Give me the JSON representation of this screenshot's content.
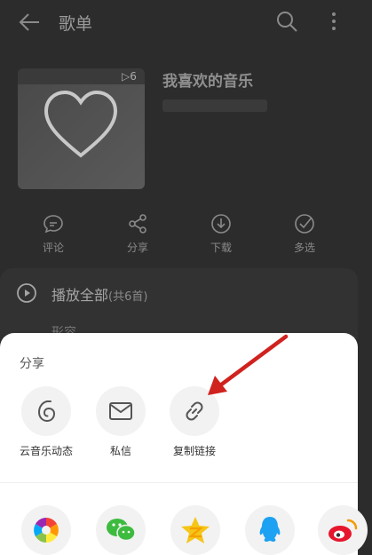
{
  "header": {
    "title": "歌单",
    "icons": [
      "back-arrow-icon",
      "search-icon",
      "more-vertical-icon"
    ]
  },
  "playlist": {
    "name": "我喜欢的音乐",
    "play_count": "6"
  },
  "actions": [
    {
      "label": "评论",
      "icon": "comment-icon"
    },
    {
      "label": "分享",
      "icon": "share-icon"
    },
    {
      "label": "下载",
      "icon": "download-icon"
    },
    {
      "label": "多选",
      "icon": "multi-select-icon"
    }
  ],
  "play_all": {
    "label": "播放全部",
    "count": "(共6首)",
    "first_song_peek": "形容"
  },
  "share_sheet": {
    "title": "分享",
    "options": [
      {
        "label": "云音乐动态",
        "icon": "cloud-music-feed-icon"
      },
      {
        "label": "私信",
        "icon": "mail-icon"
      },
      {
        "label": "复制链接",
        "icon": "link-icon"
      }
    ],
    "apps": [
      {
        "name": "moments",
        "icon": "wechat-moments-icon"
      },
      {
        "name": "wechat",
        "icon": "wechat-icon"
      },
      {
        "name": "qzone",
        "icon": "qzone-icon"
      },
      {
        "name": "qq",
        "icon": "qq-icon"
      },
      {
        "name": "weibo",
        "icon": "weibo-icon"
      }
    ]
  },
  "colors": {
    "arrow": "#d0221e",
    "dim_bg": "#2c2c2c",
    "sheet_bg": "#ffffff"
  }
}
